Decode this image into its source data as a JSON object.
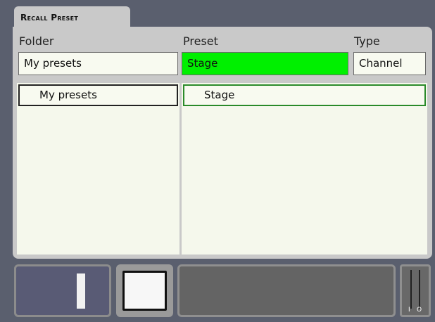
{
  "tab": {
    "title": "Recall Preset"
  },
  "columns": {
    "folder": "Folder",
    "preset": "Preset",
    "type": "Type"
  },
  "fields": {
    "folder_value": "My presets",
    "preset_value": "Stage",
    "type_value": "Channel"
  },
  "folder_list": {
    "items": [
      "My presets"
    ]
  },
  "preset_list": {
    "items": [
      "Stage"
    ]
  },
  "colors": {
    "selected_preset_field": "#00f000",
    "selected_item_border": "#2a8a2a",
    "panel": "#c9c9c9",
    "background": "#5a5f6e"
  },
  "fader": {
    "marks": [
      "I",
      "O"
    ]
  }
}
